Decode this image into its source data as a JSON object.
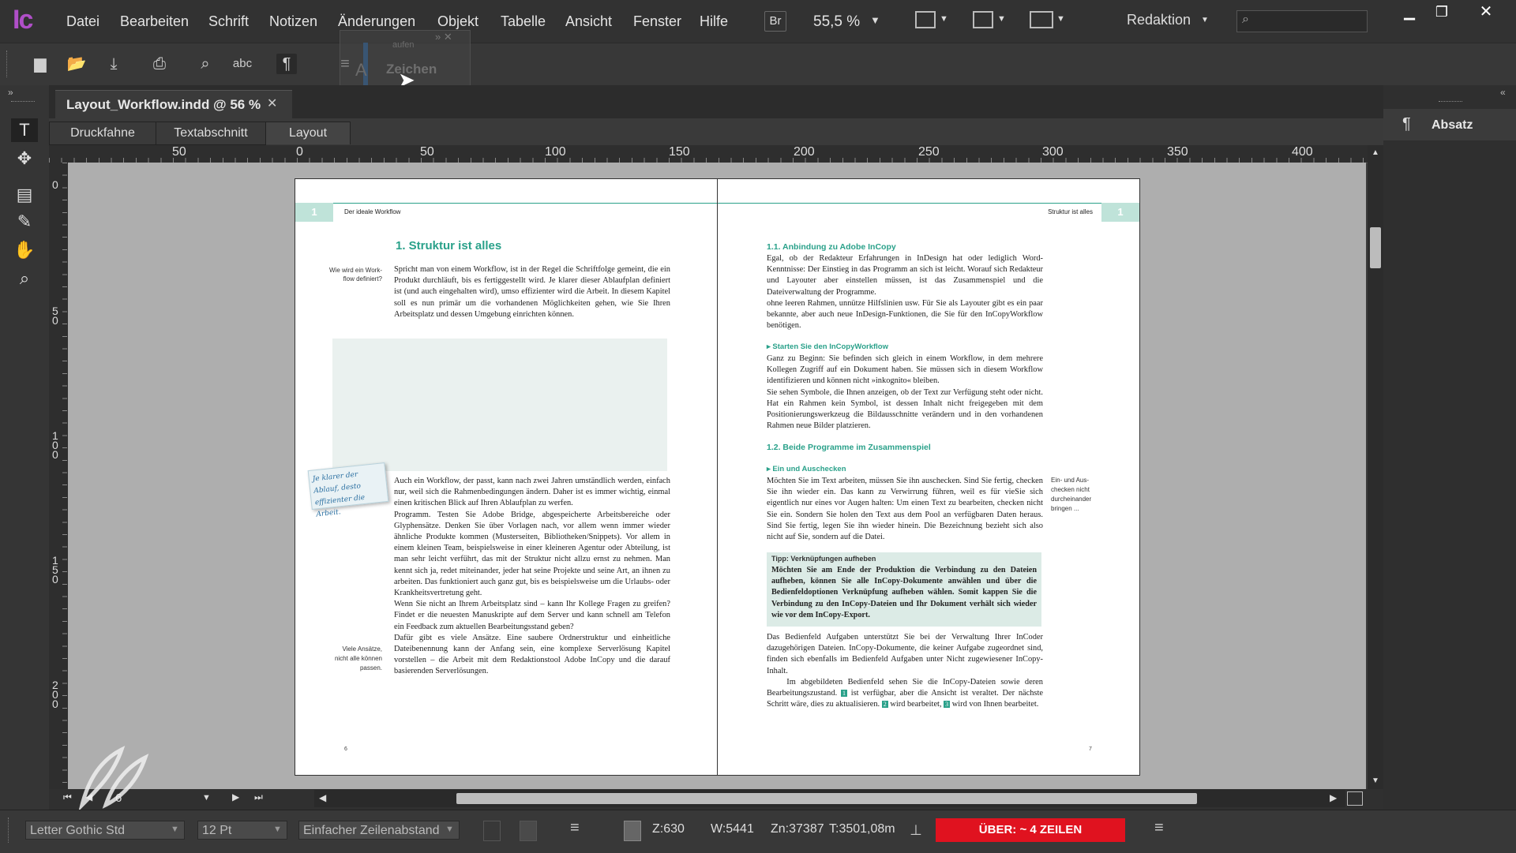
{
  "app": {
    "logo": "Ic",
    "menu": [
      "Datei",
      "Bearbeiten",
      "Schrift",
      "Notizen",
      "Änderungen",
      "Objekt",
      "Tabelle",
      "Ansicht",
      "Fenster",
      "Hilfe"
    ],
    "bridge_label": "Br",
    "zoom": "55,5 %",
    "workspace": "Redaktion"
  },
  "toolbar": {
    "tooltip_small": "aufen",
    "tooltip_label": "Zeichen"
  },
  "document": {
    "tab_title": "Layout_Workflow.indd @ 56 %",
    "view_tabs": [
      "Druckfahne",
      "Textabschnitt",
      "Layout"
    ],
    "ruler_h": [
      "50",
      "0",
      "50",
      "100",
      "150",
      "200",
      "250",
      "300",
      "350",
      "400"
    ],
    "ruler_v": [
      "0",
      "5\n0",
      "1\n0\n0",
      "1\n5\n0",
      "2\n0\n0"
    ]
  },
  "left_page": {
    "number_tab": "1",
    "running_head": "Der ideale Workflow",
    "heading": "1.  Struktur ist alles",
    "margin_note_1": "Wie wird ein Work-\nflow definiert?",
    "intro": "Spricht man von einem Workflow, ist in der Regel die Schriftfolge gemeint, die ein Produkt durchläuft, bis es fertiggestellt wird. Je klarer dieser Ablaufplan definiert ist (und auch eingehalten wird), umso effizienter wird die Arbeit. In diesem Kapitel soll es nun primär um die vorhandenen Möglichkeiten gehen, wie Sie Ihren Arbeitsplatz und dessen Umgebung einrichten können.",
    "sticky_note": "Je klarer der Ablauf, desto effizienter die Arbeit.",
    "body": "Auch ein Workflow, der passt, kann nach zwei Jahren umständlich werden, einfach nur, weil sich die Rahmenbedingungen ändern. Daher ist es immer wichtig, einmal einen kritischen Blick auf Ihren Ablaufplan zu werfen.\n    Programm. Testen Sie Adobe Bridge, abgespeicherte Arbeitsbereiche oder Glyphensätze. Denken Sie über Vorlagen nach, vor allem wenn immer wieder ähnliche Produkte kommen (Musterseiten, Bibliotheken/Snippets). Vor allem in einem kleinen Team, beispielsweise in einer kleineren Agentur oder Abteilung, ist man sehr leicht verführt, das mit der Struktur nicht allzu ernst zu nehmen. Man kennt sich ja, redet miteinander, jeder hat seine Projekte und seine Art, an ihnen zu arbeiten. Das funktioniert auch ganz gut, bis es beispielsweise um die Urlaubs- oder Krankheitsvertretung geht.\n    Wenn Sie nicht an Ihrem Arbeitsplatz sind – kann Ihr Kollege Fragen zu greifen? Findet er die neuesten Manuskripte auf dem Server und kann schnell am Telefon ein Feedback zum aktuellen Bearbeitungsstand geben?\n    Dafür gibt es viele Ansätze. Eine saubere Ordnerstruktur und einheitliche Dateibenennung kann der Anfang sein, eine komplexe Serverlösung Kapitel vorstellen – die Arbeit mit dem Redaktionstool Adobe InCopy und die darauf basierenden Serverlösungen.",
    "margin_note_2": "Viele Ansätze,\nnicht alle können\npassen.",
    "folio": "6"
  },
  "right_page": {
    "number_tab": "1",
    "running_head": "Struktur ist alles",
    "h_1_1": "1.1.  Anbindung zu Adobe InCopy",
    "p1": "Egal, ob der Redakteur Erfahrungen in InDesign hat oder lediglich Word-Kenntnisse: Der Einstieg in das Programm an sich ist leicht. Worauf sich Redakteur und Layouter aber einstellen müssen, ist das Zusammenspiel und die Dateiverwaltung der Programme.\nohne leeren Rahmen, unnütze Hilfslinien usw. Für Sie als Layouter gibt es ein paar bekannte, aber auch neue InDesign-Funktionen, die Sie für den InCopyWorkflow benötigen.",
    "sub_1": "▸  Starten Sie den InCopyWorkflow",
    "p2": "Ganz zu Beginn: Sie befinden sich gleich in einem Workflow, in dem mehrere Kollegen Zugriff auf ein Dokument haben. Sie müssen sich in diesem Workflow identifizieren und können nicht »inkognito« bleiben.\n    Sie sehen Symbole, die Ihnen anzeigen, ob der Text zur Verfügung steht oder nicht. Hat ein Rahmen kein Symbol, ist dessen Inhalt nicht freigegeben mit dem Positionierungswerkzeug die Bildausschnitte verändern und in den vorhandenen Rahmen neue Bilder platzieren.",
    "h_1_2": "1.2.  Beide Programme im Zusammenspiel",
    "sub_2": "▸  Ein und Auschecken",
    "p3": "Möchten Sie im Text arbeiten, müssen Sie ihn auschecken. Sind Sie fertig, checken Sie ihn wieder ein. Das kann zu Verwirrung führen, weil es für vieSie sich eigentlich nur eines vor Augen halten: Um einen Text zu bearbeiten, checken nicht Sie ein. Sondern Sie holen den Text aus dem Pool an verfügbaren Daten heraus. Sind Sie fertig, legen Sie ihn wieder hinein. Die Bezeichnung bezieht sich also nicht auf Sie, sondern auf die Datei.",
    "margin_note": "Ein- und Aus-\nchecken nicht\ndurcheinander\nbringen ...",
    "tip_title": "Tipp: Verknüpfungen aufheben",
    "tip_body": "Möchten Sie am Ende der Produktion die Verbindung zu den Dateien aufheben, können Sie alle InCopy-Dokumente anwählen und über die Bedienfeldoptionen Verknüpfung aufheben wählen. Somit kappen Sie die Verbindung zu den InCopy-Dateien und Ihr Dokument verhält sich wieder wie vor dem InCopy-Export.",
    "p4": "Das Bedienfeld Aufgaben unterstützt Sie bei der Verwaltung Ihrer InCoder dazugehörigen Dateien. InCopy-Dokumente, die keiner Aufgabe zugeordnet sind, finden sich ebenfalls im Bedienfeld Aufgaben unter Nicht zugewiesener InCopy-Inhalt.",
    "p5a": "    Im abgebildeten Bedienfeld sehen Sie die InCopy-Dateien sowie deren Bearbeitungszustand.",
    "badge1": "1",
    "p5b": "ist verfügbar, aber die Ansicht ist veraltet. Der nächste Schritt wäre, dies zu aktualisieren.",
    "badge2": "2",
    "p5c": "wird bearbeitet,",
    "badge3": "3",
    "p5d": "wird von Ihnen bearbeitet.",
    "folio": "7"
  },
  "right_panel": {
    "label": "Absatz"
  },
  "nav": {
    "page_field": "6"
  },
  "status": {
    "font": "Letter Gothic Std",
    "size": "12 Pt",
    "leading": "Einfacher Zeilenabstand",
    "z": "Z:630",
    "w": "W:5441",
    "zn": "Zn:37387",
    "t": "T:3501,08m",
    "overset": "ÜBER:  ~ 4 ZEILEN"
  },
  "colors": {
    "accent": "#2aa18a",
    "overset": "#e0121f",
    "logo": "#b04fc8"
  }
}
